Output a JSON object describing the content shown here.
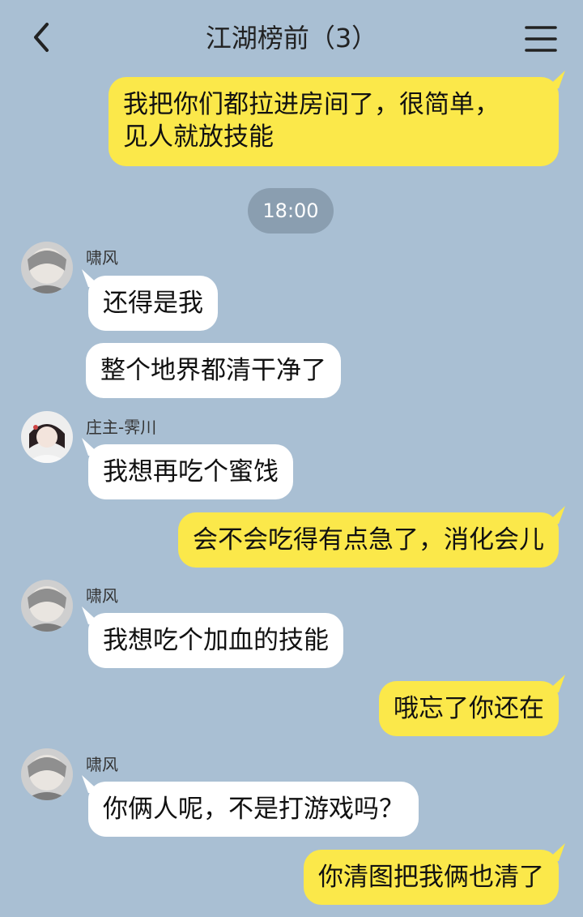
{
  "header": {
    "title": "江湖榜前（3）"
  },
  "time_divider": "18:00",
  "messages": [
    {
      "dir": "out",
      "text_line1": "我把你们都拉进房间了，很简单，",
      "text_line2": "见人就放技能"
    },
    {
      "dir": "in",
      "sender": "啸风",
      "text": "还得是我"
    },
    {
      "dir": "in",
      "text": "整个地界都清干净了"
    },
    {
      "dir": "in",
      "sender": "庄主-霁川",
      "text": "我想再吃个蜜饯"
    },
    {
      "dir": "out",
      "text": "会不会吃得有点急了，消化会儿"
    },
    {
      "dir": "in",
      "sender": "啸风",
      "text": "我想吃个加血的技能"
    },
    {
      "dir": "out",
      "text": "哦忘了你还在"
    },
    {
      "dir": "in",
      "sender": "啸风",
      "text": "你俩人呢，不是打游戏吗？"
    },
    {
      "dir": "out",
      "text": "你清图把我俩也清了"
    }
  ],
  "colors": {
    "background": "#a9bfd3",
    "outgoing_bubble": "#fbe84a",
    "incoming_bubble": "#ffffff",
    "time_pill": "#8a9eb0"
  },
  "icons": {
    "back": "chevron-left-icon",
    "menu": "menu-icon"
  }
}
